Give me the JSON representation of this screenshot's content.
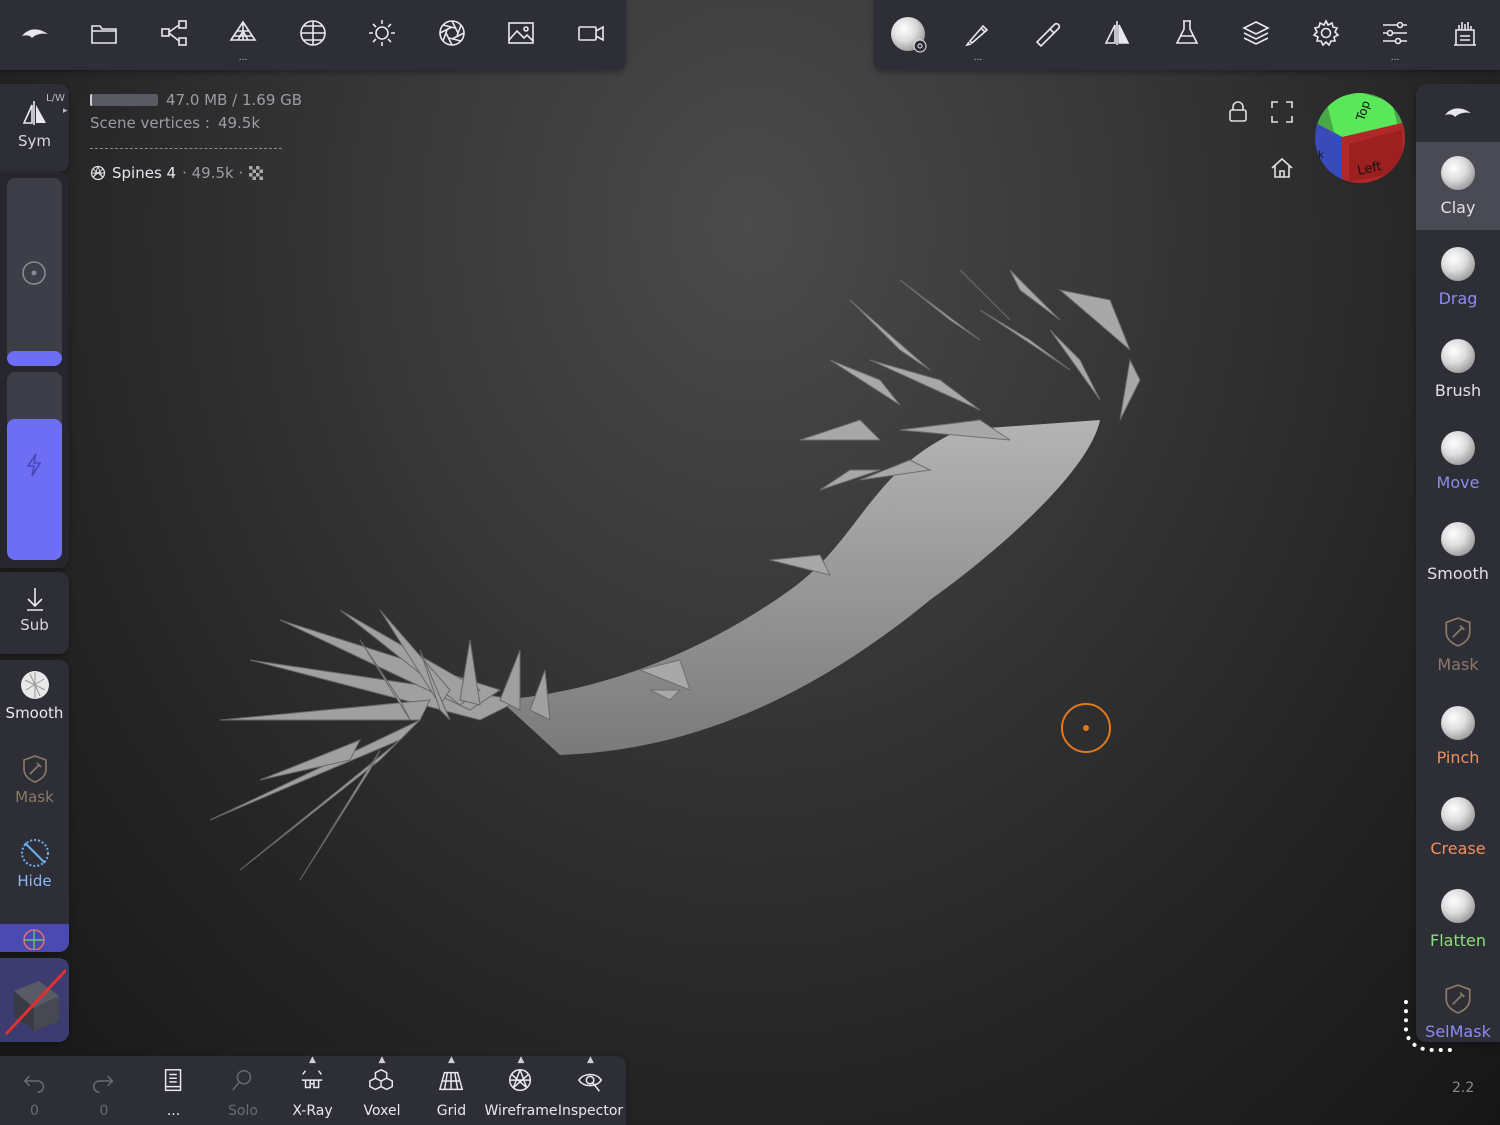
{
  "top_left_toolbar": [
    {
      "name": "logo-icon",
      "dots": ""
    },
    {
      "name": "folder-icon",
      "dots": ""
    },
    {
      "name": "scene-tree-icon",
      "dots": ""
    },
    {
      "name": "mesh-stack-icon",
      "dots": "..."
    },
    {
      "name": "material-sphere-icon",
      "dots": ""
    },
    {
      "name": "light-icon",
      "dots": ""
    },
    {
      "name": "aperture-icon",
      "dots": ""
    },
    {
      "name": "image-icon",
      "dots": ""
    },
    {
      "name": "video-camera-icon",
      "dots": ""
    }
  ],
  "top_right_toolbar": [
    {
      "name": "material-ball-icon",
      "dots": ""
    },
    {
      "name": "paint-brush-icon",
      "dots": "..."
    },
    {
      "name": "eyedropper-icon",
      "dots": ""
    },
    {
      "name": "symmetry-icon",
      "dots": ""
    },
    {
      "name": "flask-icon",
      "dots": ""
    },
    {
      "name": "layers-icon",
      "dots": ""
    },
    {
      "name": "settings-gear-icon",
      "dots": ""
    },
    {
      "name": "sliders-icon",
      "dots": "..."
    },
    {
      "name": "gesture-icon",
      "dots": ""
    }
  ],
  "hud": {
    "memory_text": "47.0 MB / 1.69 GB",
    "memory_fraction": 0.03,
    "scene_vertices_label": "Scene vertices :",
    "scene_vertices_value": "49.5k",
    "object_name": "Spines 4",
    "object_vertices": "· 49.5k ·"
  },
  "left_panel": {
    "sym_label": "Sym",
    "sym_badge": "L/W",
    "radius_fraction": 0.08,
    "intensity_fraction": 0.75,
    "sub_label": "Sub",
    "smooth_label": "Smooth",
    "mask_label": "Mask",
    "hide_label": "Hide"
  },
  "right_tools": [
    {
      "label": "Clay",
      "color": "#e0e0e6",
      "active": true
    },
    {
      "label": "Drag",
      "color": "#8c8cf0",
      "active": false
    },
    {
      "label": "Brush",
      "color": "#e0e0e6",
      "active": false
    },
    {
      "label": "Move",
      "color": "#8c8cf0",
      "active": false
    },
    {
      "label": "Smooth",
      "color": "#e0e0e6",
      "active": false
    },
    {
      "label": "Mask",
      "color": "#8a7a68",
      "active": false
    },
    {
      "label": "Pinch",
      "color": "#f09060",
      "active": false
    },
    {
      "label": "Crease",
      "color": "#f09060",
      "active": false
    },
    {
      "label": "Flatten",
      "color": "#8ae07a",
      "active": false
    },
    {
      "label": "SelMask",
      "color": "#8c8cf0",
      "active": false
    }
  ],
  "bottom_toolbar": [
    {
      "name": "undo",
      "label": "0",
      "caret": false,
      "disabled": true
    },
    {
      "name": "redo",
      "label": "0",
      "caret": false,
      "disabled": true
    },
    {
      "name": "notes",
      "label": "...",
      "caret": false,
      "disabled": false
    },
    {
      "name": "solo",
      "label": "Solo",
      "caret": false,
      "disabled": true
    },
    {
      "name": "x-ray",
      "label": "X-Ray",
      "caret": true,
      "disabled": false
    },
    {
      "name": "voxel",
      "label": "Voxel",
      "caret": true,
      "disabled": false
    },
    {
      "name": "grid",
      "label": "Grid",
      "caret": true,
      "disabled": false
    },
    {
      "name": "wireframe",
      "label": "Wireframe",
      "caret": true,
      "disabled": false
    },
    {
      "name": "inspector",
      "label": "Inspector",
      "caret": true,
      "disabled": false
    }
  ],
  "view_cube": {
    "top_label": "Top",
    "left_label": "Left",
    "back_label": "k"
  },
  "version": "2.2",
  "colors": {
    "accent": "#6e6ef5",
    "cursor": "#e07820",
    "panel": "#2e2e36"
  }
}
